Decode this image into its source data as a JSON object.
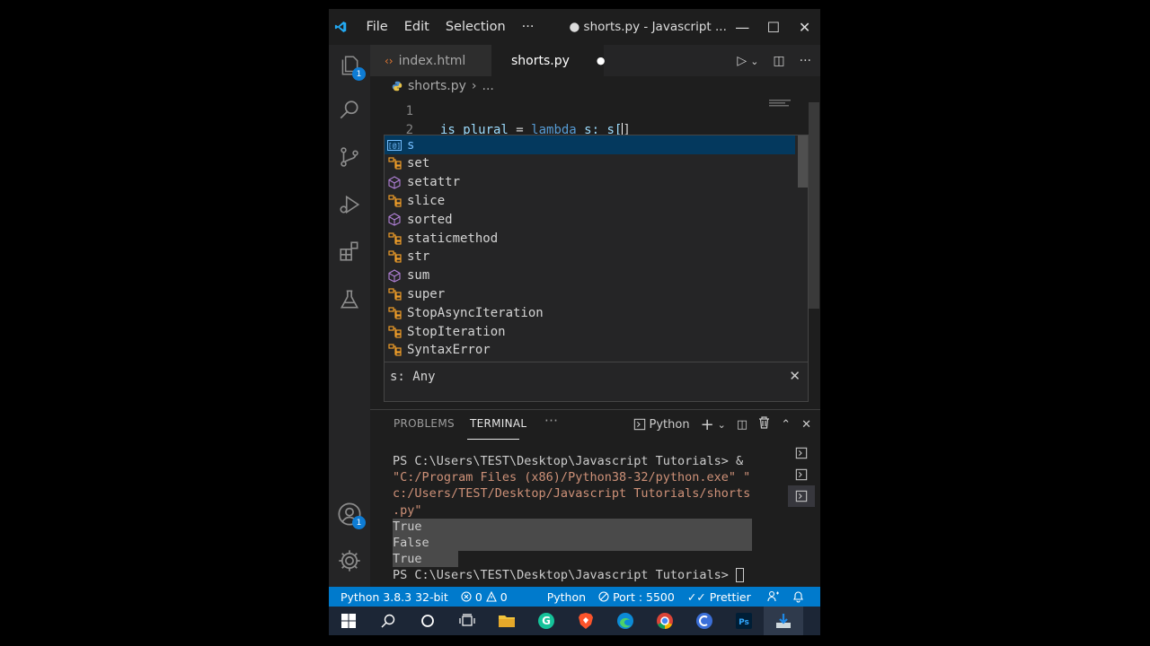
{
  "titlebar": {
    "menus": [
      "File",
      "Edit",
      "Selection",
      "···"
    ],
    "title": "● shorts.py - Javascript ...",
    "minimize": "—",
    "maximize": "☐",
    "close": "✕"
  },
  "activity": {
    "explorer_badge": "1",
    "accounts_badge": "1"
  },
  "tabs": [
    {
      "label": "index.html",
      "icon": "‹›"
    },
    {
      "label": "shorts.py",
      "dirty": "●"
    }
  ],
  "editor_actions": {
    "run": "▷",
    "run_menu": "⌄",
    "split": "◫",
    "more": "···"
  },
  "breadcrumb": {
    "file": "shorts.py",
    "sep": "›",
    "rest": "..."
  },
  "editor": {
    "lines": [
      {
        "num": "1",
        "text": ""
      },
      {
        "num": "2",
        "text_var": "is_plural",
        "text_eq": " = ",
        "text_kw": "lambda",
        "text_rest": " s: s[",
        "text_close": "]"
      }
    ]
  },
  "suggest": {
    "items": [
      {
        "label": "s",
        "kind": "variable"
      },
      {
        "label": "set",
        "kind": "class"
      },
      {
        "label": "setattr",
        "kind": "function"
      },
      {
        "label": "slice",
        "kind": "class"
      },
      {
        "label": "sorted",
        "kind": "function"
      },
      {
        "label": "staticmethod",
        "kind": "class"
      },
      {
        "label": "str",
        "kind": "class"
      },
      {
        "label": "sum",
        "kind": "function"
      },
      {
        "label": "super",
        "kind": "class"
      },
      {
        "label": "StopAsyncIteration",
        "kind": "class"
      },
      {
        "label": "StopIteration",
        "kind": "class"
      },
      {
        "label": "SyntaxError",
        "kind": "class"
      }
    ],
    "detail": "s: Any",
    "close": "✕"
  },
  "panel": {
    "tabs": [
      "PROBLEMS",
      "TERMINAL",
      "···"
    ],
    "active_tab": "TERMINAL",
    "shell": "Python",
    "actions": {
      "add": "+",
      "add_menu": "⌄",
      "split": "◫",
      "trash": "🗑",
      "maximize": "⌃",
      "close": "✕"
    },
    "terminal_lines": [
      "PS C:\\Users\\TEST\\Desktop\\Javascript Tutorials> &",
      "\"C:/Program Files (x86)/Python38-32/python.exe\" \"",
      "c:/Users/TEST/Desktop/Javascript Tutorials/shorts",
      ".py\"",
      "True",
      "False",
      "True",
      "PS C:\\Users\\TEST\\Desktop\\Javascript Tutorials> "
    ]
  },
  "statusbar": {
    "interpreter": "Python 3.8.3 32-bit",
    "errors": "0",
    "warnings": "0",
    "language": "Python",
    "port": "Port : 5500",
    "prettier": "Prettier"
  },
  "taskbar": {
    "apps": [
      "windows-start",
      "search",
      "cortana",
      "task-view",
      "file-explorer",
      "grammarly",
      "brave",
      "edge",
      "chrome",
      "cortana-app",
      "photoshop",
      "installer"
    ]
  },
  "colors": {
    "accent": "#007acc",
    "editor_bg": "#1e1e1e",
    "keyword": "#569cd6",
    "variable": "#9cdcfe",
    "string": "#ce9178",
    "suggest_class_icon": "#ee9d28",
    "suggest_fn_icon": "#b180d7",
    "suggest_selected": "#04395e"
  }
}
